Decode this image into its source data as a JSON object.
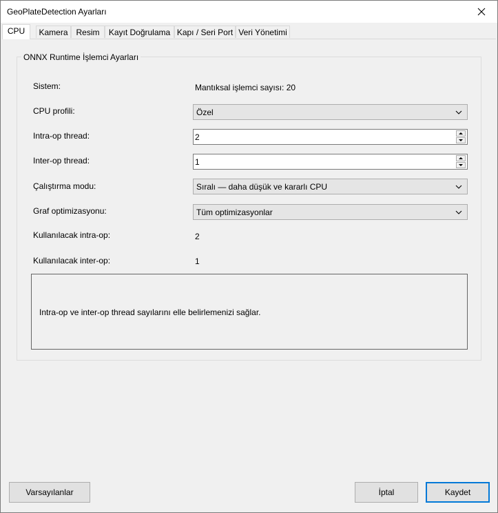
{
  "window": {
    "title": "GeoPlateDetection Ayarları"
  },
  "tabs": [
    {
      "label": "CPU",
      "active": true
    },
    {
      "label": "Kamera"
    },
    {
      "label": "Resim"
    },
    {
      "label": "Kayıt Doğrulama"
    },
    {
      "label": "Kapı / Seri Port"
    },
    {
      "label": "Veri Yönetimi"
    }
  ],
  "group": {
    "title": "ONNX Runtime İşlemci Ayarları"
  },
  "fields": {
    "system": {
      "label": "Sistem:",
      "value": "Mantıksal işlemci sayısı: 20"
    },
    "cpu_profile": {
      "label": "CPU profili:",
      "value": "Özel"
    },
    "intra_op": {
      "label": "Intra-op thread:",
      "value": "2"
    },
    "inter_op": {
      "label": "Inter-op thread:",
      "value": "1"
    },
    "execution_mode": {
      "label": "Çalıştırma modu:",
      "value": "Sıralı — daha düşük ve kararlı CPU"
    },
    "graph_opt": {
      "label": "Graf optimizasyonu:",
      "value": "Tüm optimizasyonlar"
    },
    "used_intra": {
      "label": "Kullanılacak intra-op:",
      "value": "2"
    },
    "used_inter": {
      "label": "Kullanılacak inter-op:",
      "value": "1"
    }
  },
  "description": "Intra-op ve inter-op thread sayılarını elle belirlemenizi sağlar.",
  "buttons": {
    "defaults": "Varsayılanlar",
    "cancel": "İptal",
    "save": "Kaydet"
  },
  "colors": {
    "accent": "#0078d7",
    "background": "#f0f0f0"
  },
  "icons": {
    "close": "close-icon",
    "dropdown": "chevron-down-icon"
  }
}
